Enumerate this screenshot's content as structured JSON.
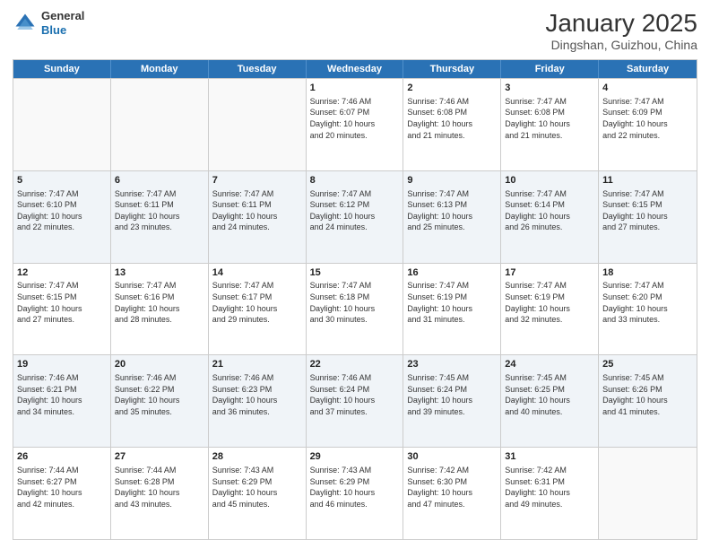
{
  "header": {
    "logo_general": "General",
    "logo_blue": "Blue",
    "month_title": "January 2025",
    "subtitle": "Dingshan, Guizhou, China"
  },
  "weekdays": [
    "Sunday",
    "Monday",
    "Tuesday",
    "Wednesday",
    "Thursday",
    "Friday",
    "Saturday"
  ],
  "rows": [
    {
      "shaded": false,
      "cells": [
        {
          "day": "",
          "empty": true
        },
        {
          "day": "",
          "empty": true
        },
        {
          "day": "",
          "empty": true
        },
        {
          "day": "1",
          "sunrise": "7:46 AM",
          "sunset": "6:07 PM",
          "daylight": "10 hours and 20 minutes."
        },
        {
          "day": "2",
          "sunrise": "7:46 AM",
          "sunset": "6:08 PM",
          "daylight": "10 hours and 21 minutes."
        },
        {
          "day": "3",
          "sunrise": "7:47 AM",
          "sunset": "6:08 PM",
          "daylight": "10 hours and 21 minutes."
        },
        {
          "day": "4",
          "sunrise": "7:47 AM",
          "sunset": "6:09 PM",
          "daylight": "10 hours and 22 minutes."
        }
      ]
    },
    {
      "shaded": true,
      "cells": [
        {
          "day": "5",
          "sunrise": "7:47 AM",
          "sunset": "6:10 PM",
          "daylight": "10 hours and 22 minutes."
        },
        {
          "day": "6",
          "sunrise": "7:47 AM",
          "sunset": "6:11 PM",
          "daylight": "10 hours and 23 minutes."
        },
        {
          "day": "7",
          "sunrise": "7:47 AM",
          "sunset": "6:11 PM",
          "daylight": "10 hours and 24 minutes."
        },
        {
          "day": "8",
          "sunrise": "7:47 AM",
          "sunset": "6:12 PM",
          "daylight": "10 hours and 24 minutes."
        },
        {
          "day": "9",
          "sunrise": "7:47 AM",
          "sunset": "6:13 PM",
          "daylight": "10 hours and 25 minutes."
        },
        {
          "day": "10",
          "sunrise": "7:47 AM",
          "sunset": "6:14 PM",
          "daylight": "10 hours and 26 minutes."
        },
        {
          "day": "11",
          "sunrise": "7:47 AM",
          "sunset": "6:15 PM",
          "daylight": "10 hours and 27 minutes."
        }
      ]
    },
    {
      "shaded": false,
      "cells": [
        {
          "day": "12",
          "sunrise": "7:47 AM",
          "sunset": "6:15 PM",
          "daylight": "10 hours and 27 minutes."
        },
        {
          "day": "13",
          "sunrise": "7:47 AM",
          "sunset": "6:16 PM",
          "daylight": "10 hours and 28 minutes."
        },
        {
          "day": "14",
          "sunrise": "7:47 AM",
          "sunset": "6:17 PM",
          "daylight": "10 hours and 29 minutes."
        },
        {
          "day": "15",
          "sunrise": "7:47 AM",
          "sunset": "6:18 PM",
          "daylight": "10 hours and 30 minutes."
        },
        {
          "day": "16",
          "sunrise": "7:47 AM",
          "sunset": "6:19 PM",
          "daylight": "10 hours and 31 minutes."
        },
        {
          "day": "17",
          "sunrise": "7:47 AM",
          "sunset": "6:19 PM",
          "daylight": "10 hours and 32 minutes."
        },
        {
          "day": "18",
          "sunrise": "7:47 AM",
          "sunset": "6:20 PM",
          "daylight": "10 hours and 33 minutes."
        }
      ]
    },
    {
      "shaded": true,
      "cells": [
        {
          "day": "19",
          "sunrise": "7:46 AM",
          "sunset": "6:21 PM",
          "daylight": "10 hours and 34 minutes."
        },
        {
          "day": "20",
          "sunrise": "7:46 AM",
          "sunset": "6:22 PM",
          "daylight": "10 hours and 35 minutes."
        },
        {
          "day": "21",
          "sunrise": "7:46 AM",
          "sunset": "6:23 PM",
          "daylight": "10 hours and 36 minutes."
        },
        {
          "day": "22",
          "sunrise": "7:46 AM",
          "sunset": "6:24 PM",
          "daylight": "10 hours and 37 minutes."
        },
        {
          "day": "23",
          "sunrise": "7:45 AM",
          "sunset": "6:24 PM",
          "daylight": "10 hours and 39 minutes."
        },
        {
          "day": "24",
          "sunrise": "7:45 AM",
          "sunset": "6:25 PM",
          "daylight": "10 hours and 40 minutes."
        },
        {
          "day": "25",
          "sunrise": "7:45 AM",
          "sunset": "6:26 PM",
          "daylight": "10 hours and 41 minutes."
        }
      ]
    },
    {
      "shaded": false,
      "cells": [
        {
          "day": "26",
          "sunrise": "7:44 AM",
          "sunset": "6:27 PM",
          "daylight": "10 hours and 42 minutes."
        },
        {
          "day": "27",
          "sunrise": "7:44 AM",
          "sunset": "6:28 PM",
          "daylight": "10 hours and 43 minutes."
        },
        {
          "day": "28",
          "sunrise": "7:43 AM",
          "sunset": "6:29 PM",
          "daylight": "10 hours and 45 minutes."
        },
        {
          "day": "29",
          "sunrise": "7:43 AM",
          "sunset": "6:29 PM",
          "daylight": "10 hours and 46 minutes."
        },
        {
          "day": "30",
          "sunrise": "7:42 AM",
          "sunset": "6:30 PM",
          "daylight": "10 hours and 47 minutes."
        },
        {
          "day": "31",
          "sunrise": "7:42 AM",
          "sunset": "6:31 PM",
          "daylight": "10 hours and 49 minutes."
        },
        {
          "day": "",
          "empty": true
        }
      ]
    }
  ],
  "labels": {
    "sunrise_prefix": "Sunrise: ",
    "sunset_prefix": "Sunset: ",
    "daylight_prefix": "Daylight: "
  }
}
